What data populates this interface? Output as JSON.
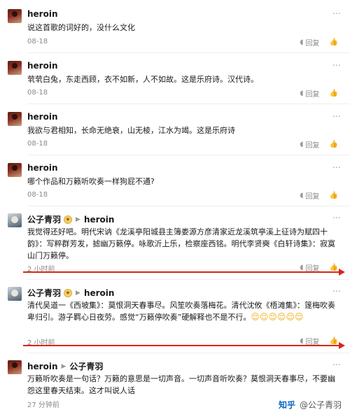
{
  "actions": {
    "reply_label": "回复",
    "like_icon": "thumbs-up-icon",
    "reply_icon": "reply-icon",
    "more_icon": "more-dots-icon"
  },
  "comments": [
    {
      "author": "heroin",
      "text": "说这首歌的词好的，没什么文化",
      "date": "08-18"
    },
    {
      "author": "heroin",
      "text": "茕茕白兔，东走西顾，衣不如新，人不如故。这是乐府诗。汉代诗。",
      "date": "08-18"
    },
    {
      "author": "heroin",
      "text": "我欲与君相知，长命无绝衰，山无棱，江水为竭。这是乐府诗",
      "date": "08-18"
    },
    {
      "author": "heroin",
      "text": "哪个作品和万籁听吹奏一样狗屁不通?",
      "date": "08-18"
    },
    {
      "author": "公子青羽",
      "reply_to": "heroin",
      "text": "我觉得还好吧。明代宋讷《龙溪亭阳城县主簿娄源方彦清家近龙溪筑亭溪上征诗为赋四十韵》：写粹群芳发，摅幽万籁停。咏歌沂上乐，检察座西铭。明代李贤奭《白轩诗集》：寂寞山门万籁停。",
      "date": "2 小时前"
    },
    {
      "author": "公子青羽",
      "reply_to": "heroin",
      "text": "清代吴道一《西坡集》：莫恨洞天春事尽。风笙吹奏落梅花。清代沈攸《梧滩集》：篴梅吹奏卑归引。游子羁心日夜劳。感觉“万籁停吹奏”硬解释也不是不行。",
      "emojis": "😌😌😌😌😌😌",
      "date": "2 小时前"
    },
    {
      "author": "heroin",
      "reply_to": "公子青羽",
      "text": "万籁听吹奏是一句话？万籁的意思是一切声音。一切声音听吹奏？莫恨洞天春事尽，不要幽怨这里春天结束。这才叫说人话",
      "date": "27 分钟前"
    }
  ],
  "watermark": {
    "logo": "知乎",
    "handle": "@公子青羽"
  },
  "colors": {
    "annotation_red": "#d9241a",
    "meta_gray": "#8a8a8a"
  }
}
